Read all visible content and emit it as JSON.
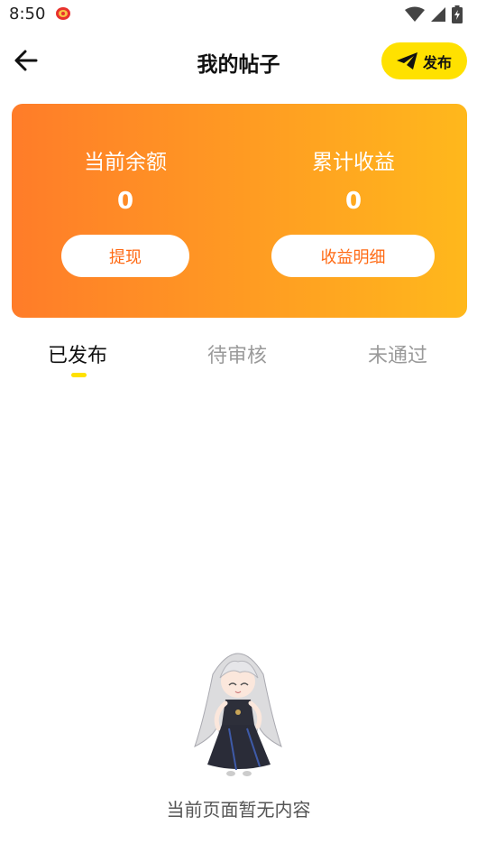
{
  "status_bar": {
    "time": "8:50"
  },
  "header": {
    "title": "我的帖子",
    "publish_label": "发布"
  },
  "balance_card": {
    "current_balance_label": "当前余额",
    "current_balance_value": "0",
    "total_income_label": "累计收益",
    "total_income_value": "0",
    "withdraw_label": "提现",
    "income_detail_label": "收益明细",
    "gradient_colors": [
      "#ff7c29",
      "#ffb81c"
    ]
  },
  "tabs": [
    {
      "label": "已发布",
      "active": true
    },
    {
      "label": "待审核",
      "active": false
    },
    {
      "label": "未通过",
      "active": false
    }
  ],
  "empty_state": {
    "message": "当前页面暂无内容"
  },
  "colors": {
    "accent": "#ffe100",
    "button_text": "#ff6a14"
  }
}
